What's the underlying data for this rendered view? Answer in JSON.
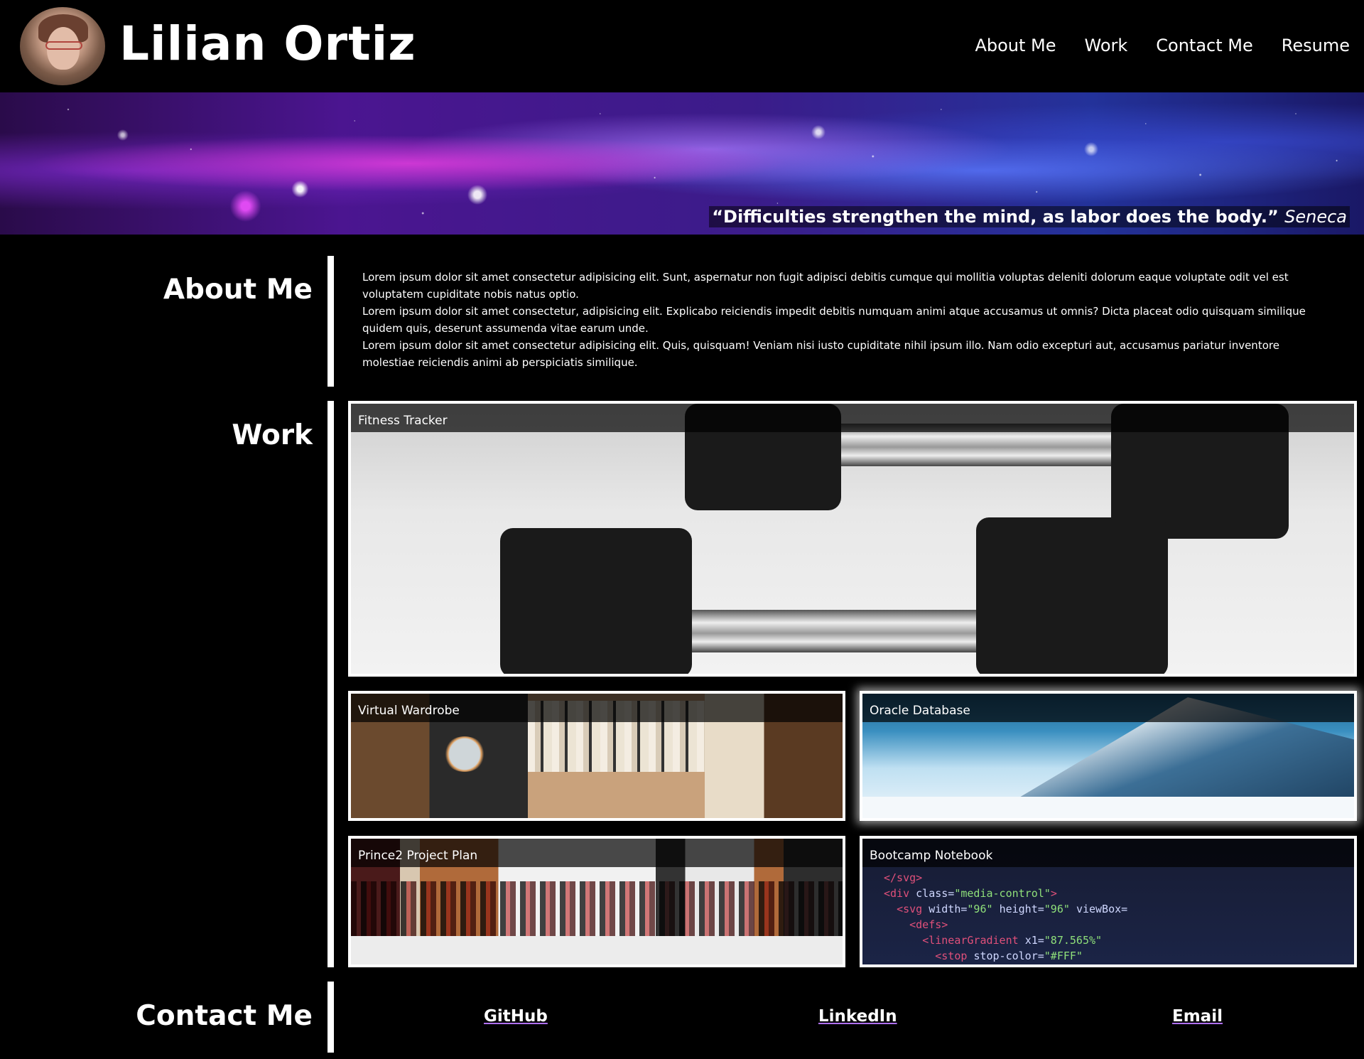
{
  "header": {
    "name": "Lilian Ortiz",
    "nav": [
      "About Me",
      "Work",
      "Contact Me",
      "Resume"
    ]
  },
  "hero": {
    "quote": "“Difficulties strengthen the mind, as labor does the body.”",
    "author": "Seneca"
  },
  "about": {
    "title": "About Me",
    "paragraphs": [
      "Lorem ipsum dolor sit amet consectetur adipisicing elit. Sunt, aspernatur non fugit adipisci debitis cumque qui mollitia voluptas deleniti dolorum eaque voluptate odit vel est voluptatem cupiditate nobis natus optio.",
      "Lorem ipsum dolor sit amet consectetur, adipisicing elit. Explicabo reiciendis impedit debitis numquam animi atque accusamus ut omnis? Dicta placeat odio quisquam similique quidem quis, deserunt assumenda vitae earum unde.",
      "Lorem ipsum dolor sit amet consectetur adipisicing elit. Quis, quisquam! Veniam nisi iusto cupiditate nihil ipsum illo. Nam odio excepturi aut, accusamus pariatur inventore molestiae reiciendis animi ab perspiciatis similique."
    ]
  },
  "work": {
    "title": "Work",
    "projects": [
      "Fitness Tracker",
      "Virtual Wardrobe",
      "Oracle Database",
      "Prince2 Project Plan",
      "Bootcamp Notebook"
    ]
  },
  "contact": {
    "title": "Contact Me",
    "links": [
      "GitHub",
      "LinkedIn",
      "Email"
    ]
  },
  "colors": {
    "background": "#000000",
    "text": "#ffffff",
    "link_underline": "#b070ff"
  }
}
